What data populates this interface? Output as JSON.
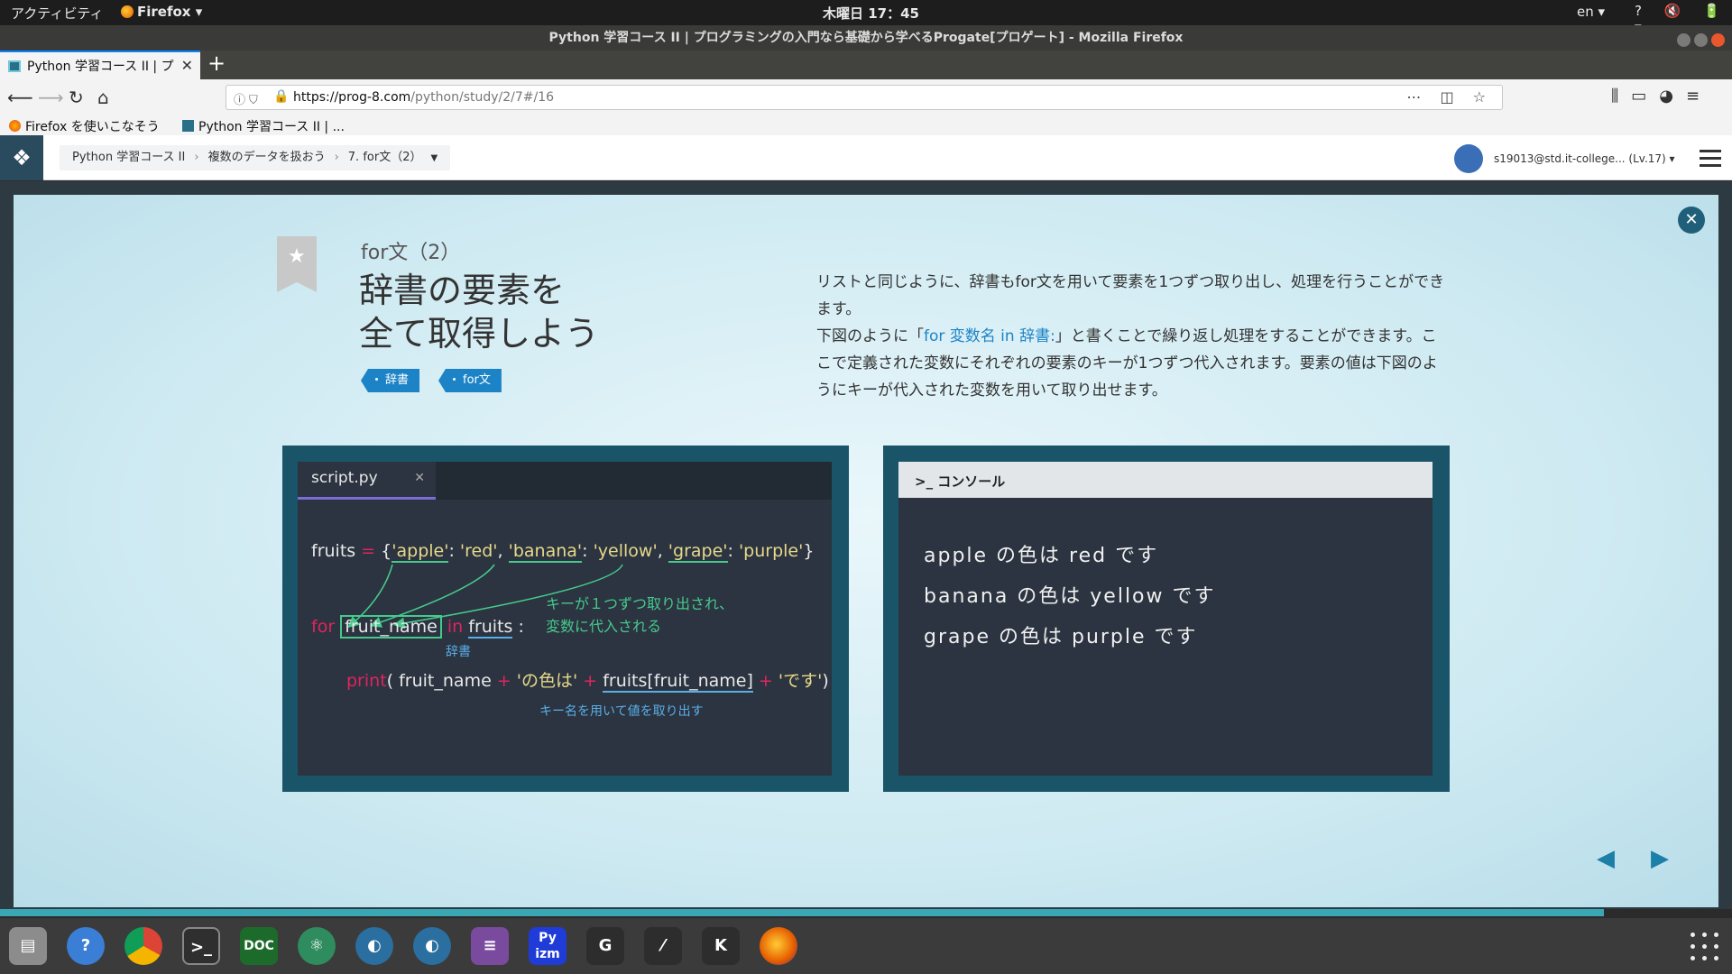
{
  "system": {
    "activities": "アクティビティ",
    "app_menu": "Firefox",
    "clock": "木曜日 17：45",
    "lang": "en"
  },
  "window": {
    "title": "Python 学習コース II | プログラミングの入門なら基礎から学べるProgate[プロゲート] - Mozilla Firefox"
  },
  "browser": {
    "tab_title": "Python 学習コース II | プ",
    "url_host": "https://prog-8.com",
    "url_path": "/python/study/2/7#/16",
    "bookmarks": [
      "Firefox を使いこなそう",
      "Python 学習コース II | ..."
    ]
  },
  "progate": {
    "breadcrumb": [
      "Python 学習コース II",
      "複数のデータを扱おう",
      "7. for文（2）"
    ],
    "user": "s19013@std.it-college... (Lv.17)"
  },
  "lesson": {
    "number": "for文（2）",
    "title_line1": "辞書の要素を",
    "title_line2": "全て取得しよう",
    "tags": [
      "辞書",
      "for文"
    ],
    "desc1": "リストと同じように、辞書もfor文を用いて要素を1つずつ取り出し、処理を行うことができます。",
    "desc2_pre": "下図のように「",
    "desc2_hl": "for 変数名 in 辞書:",
    "desc2_post": "」と書くことで繰り返し処理をすることができます。ここで定義された変数にそれぞれの要素のキーが1つずつ代入されます。要素の値は下図のようにキーが代入された変数を用いて取り出せます。"
  },
  "editor": {
    "filename": "script.py",
    "line1": {
      "var": "fruits",
      "eq": " = ",
      "open": "{",
      "k1": "'apple'",
      "v1": "'red'",
      "k2": "'banana'",
      "v2": "'yellow'",
      "k3": "'grape'",
      "v3": "'purple'",
      "close": "}"
    },
    "line2": {
      "kw_for": "for",
      "var": "fruit_name",
      "kw_in": "in",
      "dict": "fruits",
      "colon": " :"
    },
    "line3": {
      "fn": "print",
      "open": "( ",
      "var": "fruit_name",
      "plus1": " + ",
      "s1": "'の色は'",
      "plus2": " + ",
      "expr": "fruits[fruit_name]",
      "plus3": " + ",
      "s2": "'です'",
      "close": ")"
    },
    "note_green_1": "キーが１つずつ取り出され、",
    "note_green_2": "変数に代入される",
    "note_dict": "辞書",
    "note_value": "キー名を用いて値を取り出す"
  },
  "console": {
    "header": "コンソール",
    "lines": [
      "apple の色は red です",
      "banana の色は yellow です",
      "grape の色は purple です"
    ]
  },
  "colors": {
    "accent": "#1c84c6",
    "panel": "#1a5468",
    "code_bg": "#2b3440",
    "green": "#46c98c"
  },
  "icons": [
    "close-icon",
    "star-icon",
    "prev-arrow-icon",
    "next-arrow-icon",
    "hamburger-icon"
  ]
}
